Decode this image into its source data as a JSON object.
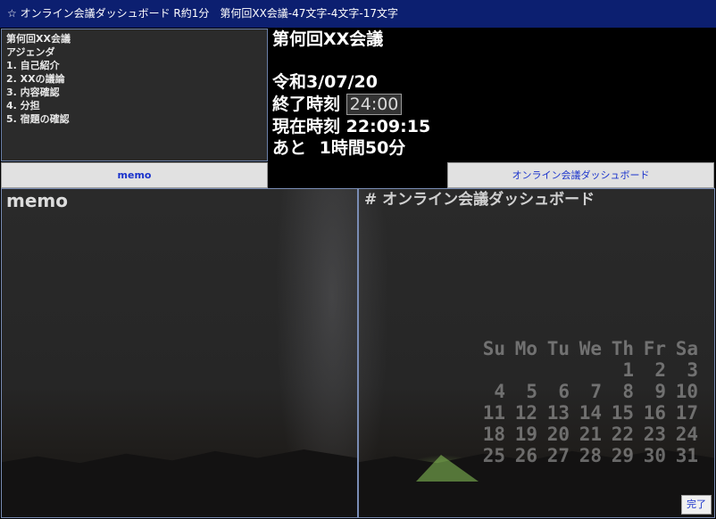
{
  "window": {
    "title": "☆ オンライン会議ダッシュボード R約1分　第何回XX会議-47文字-4文字-17文字"
  },
  "agenda": {
    "lines": [
      "第何回XX会議",
      "アジェンダ",
      "1. 自己紹介",
      "2. XXの議論",
      "3. 内容確認",
      "4. 分担",
      "5. 宿題の確認"
    ]
  },
  "info": {
    "meeting_title": "第何回XX会議",
    "date": "令和3/07/20",
    "end_label": "終了時刻",
    "end_value": "24:00",
    "now_label": "現在時刻",
    "now_value": "22:09:15",
    "remain_label": "あと",
    "remain_value": "1時間50分"
  },
  "tabs": {
    "memo": "memo",
    "dashboard": "オンライン会議ダッシュボード"
  },
  "memo_panel": {
    "title": "memo"
  },
  "dashboard_panel": {
    "title": "# オンライン会議ダッシュボード"
  },
  "calendar": {
    "weekdays": [
      "Su",
      "Mo",
      "Tu",
      "We",
      "Th",
      "Fr",
      "Sa"
    ],
    "weeks": [
      [
        "",
        "",
        "",
        "",
        "1",
        "2",
        "3"
      ],
      [
        "4",
        "5",
        "6",
        "7",
        "8",
        "9",
        "10"
      ],
      [
        "11",
        "12",
        "13",
        "14",
        "15",
        "16",
        "17"
      ],
      [
        "18",
        "19",
        "20",
        "21",
        "22",
        "23",
        "24"
      ],
      [
        "25",
        "26",
        "27",
        "28",
        "29",
        "30",
        "31"
      ]
    ]
  },
  "buttons": {
    "done": "完了"
  },
  "colors": {
    "titlebar": "#0c1f70",
    "tab_text": "#1a33cc",
    "border": "#7a8db5"
  }
}
